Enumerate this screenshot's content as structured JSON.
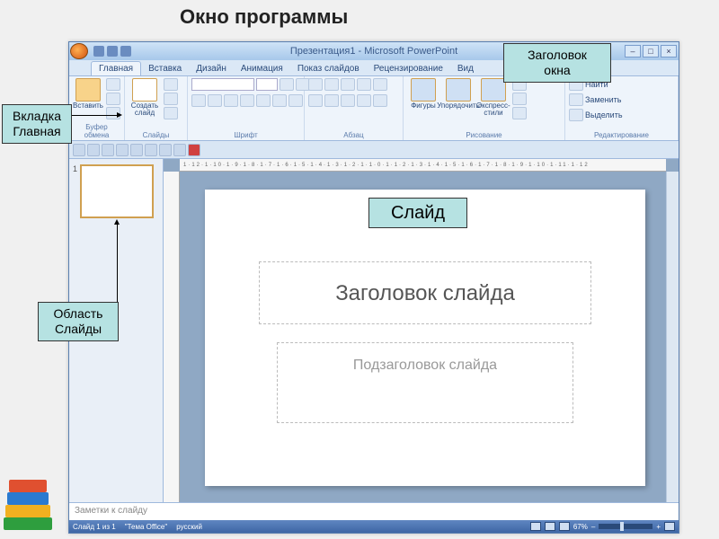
{
  "page_title": "Окно программы",
  "annotations": {
    "title": "Заголовок окна",
    "main_tab": "Вкладка Главная",
    "slides_area": "Область Слайды",
    "slide": "Слайд"
  },
  "window": {
    "title": "Презентация1 - Microsoft PowerPoint",
    "controls": {
      "min": "–",
      "max": "□",
      "close": "×"
    }
  },
  "tabs": [
    "Главная",
    "Вставка",
    "Дизайн",
    "Анимация",
    "Показ слайдов",
    "Рецензирование",
    "Вид"
  ],
  "active_tab_index": 0,
  "ribbon": {
    "groups": [
      {
        "label": "Буфер обмена",
        "big": "Вставить"
      },
      {
        "label": "Слайды",
        "big": "Создать слайд"
      },
      {
        "label": "Шрифт"
      },
      {
        "label": "Абзац"
      },
      {
        "label": "Рисование",
        "items": [
          "Фигуры",
          "Упорядочить",
          "Экспресс-стили"
        ]
      },
      {
        "label": "Редактирование",
        "rows": [
          "Найти",
          "Заменить",
          "Выделить"
        ]
      }
    ]
  },
  "ruler": "1·12·1·10·1·9·1·8·1·7·1·6·1·5·1·4·1·3·1·2·1·1·0·1·1·2·1·3·1·4·1·5·1·6·1·7·1·8·1·9·1·10·1·11·1·12",
  "thumb_number": "1",
  "slide": {
    "title_placeholder": "Заголовок слайда",
    "subtitle_placeholder": "Подзаголовок слайда"
  },
  "notes_placeholder": "Заметки к слайду",
  "status": {
    "slide_of": "Слайд 1 из 1",
    "theme": "\"Тема Office\"",
    "lang": "русский",
    "zoom": "67%"
  }
}
